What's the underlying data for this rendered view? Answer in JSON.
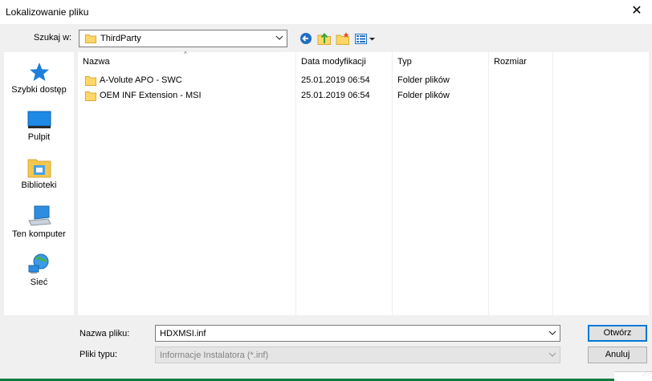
{
  "window": {
    "title": "Lokalizowanie pliku",
    "close_glyph": "✕"
  },
  "look_in": {
    "label": "Szukaj w:",
    "value": "ThirdParty"
  },
  "toolbar": {
    "icons": [
      "back-icon",
      "up-folder-icon",
      "new-folder-icon",
      "view-menu-icon"
    ]
  },
  "places": [
    {
      "label": "Szybki dostęp",
      "icon": "star-icon"
    },
    {
      "label": "Pulpit",
      "icon": "desktop-icon"
    },
    {
      "label": "Biblioteki",
      "icon": "libraries-icon"
    },
    {
      "label": "Ten komputer",
      "icon": "computer-icon"
    },
    {
      "label": "Sieć",
      "icon": "network-icon"
    }
  ],
  "columns": [
    "Nazwa",
    "Data modyfikacji",
    "Typ",
    "Rozmiar"
  ],
  "files": [
    {
      "name": "A-Volute APO - SWC",
      "date": "25.01.2019 06:54",
      "type": "Folder plików",
      "size": ""
    },
    {
      "name": "OEM INF Extension - MSI",
      "date": "25.01.2019 06:54",
      "type": "Folder plików",
      "size": ""
    }
  ],
  "filename": {
    "label": "Nazwa pliku:",
    "value": "HDXMSI.inf"
  },
  "filetype": {
    "label": "Pliki typu:",
    "value": "Informacje Instalatora (*.inf)"
  },
  "buttons": {
    "open": "Otwórz",
    "cancel": "Anuluj"
  },
  "colors": {
    "accent": "#0078d7",
    "folder": "#ffd766",
    "bottom_bar": "#0f7b3f"
  }
}
